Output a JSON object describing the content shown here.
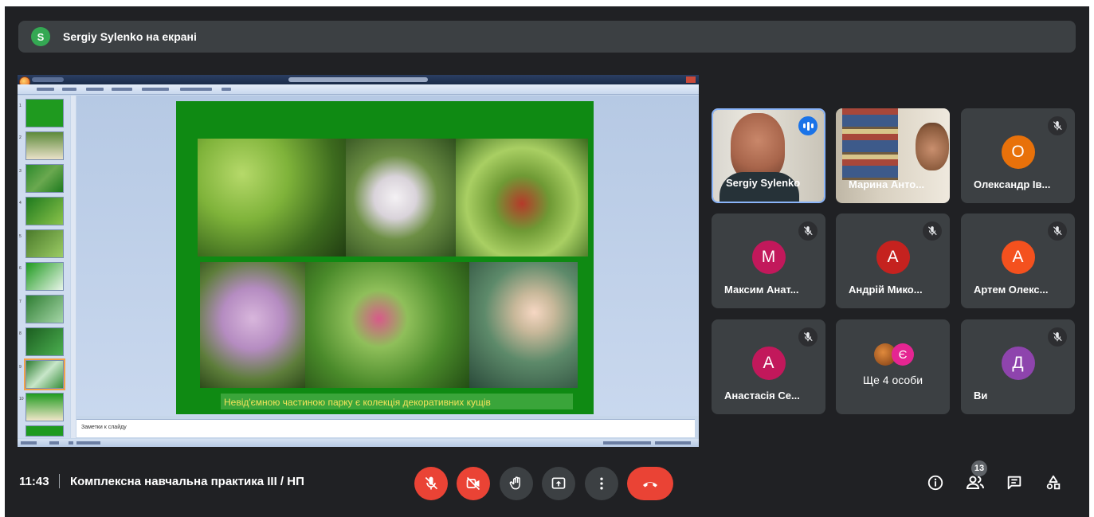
{
  "banner": {
    "avatar_letter": "S",
    "text": "Sergiy Sylenko на екрані"
  },
  "presentation": {
    "caption": "Невід'ємною частиною парку є колекція декоративних кущів",
    "notes_placeholder": "Заметки к слайду",
    "thumb_numbers": [
      "1",
      "2",
      "3",
      "4",
      "5",
      "6",
      "7",
      "8",
      "9",
      "10"
    ]
  },
  "participants": [
    {
      "name": "Sergiy Sylenko",
      "type": "video",
      "speaking": true
    },
    {
      "name": "Марина Анто...",
      "type": "video",
      "speaking": false
    },
    {
      "name": "Олександр Ів...",
      "letter": "О",
      "color": "#e8710a",
      "muted": true
    },
    {
      "name": "Максим Анат...",
      "letter": "М",
      "color": "#c2185b",
      "muted": true
    },
    {
      "name": "Андрій Мико...",
      "letter": "А",
      "color": "#c5221f",
      "muted": true
    },
    {
      "name": "Артем Олекс...",
      "letter": "А",
      "color": "#f4511e",
      "muted": true
    },
    {
      "name": "Анастасія Се...",
      "letter": "А",
      "color": "#c2185b",
      "muted": true
    },
    {
      "name": "Ще 4 особи",
      "letter": "Є",
      "color": "#e52592"
    },
    {
      "name": "Ви",
      "letter": "Д",
      "color": "#8e44ad",
      "muted": true
    }
  ],
  "bottom": {
    "time": "11:43",
    "meeting_title": "Комплексна навчальна практика III / НП",
    "participant_count": "13"
  },
  "colors": {
    "background": "#202124",
    "tile": "#3c4043",
    "danger": "#ea4335",
    "accent": "#1a73e8"
  }
}
